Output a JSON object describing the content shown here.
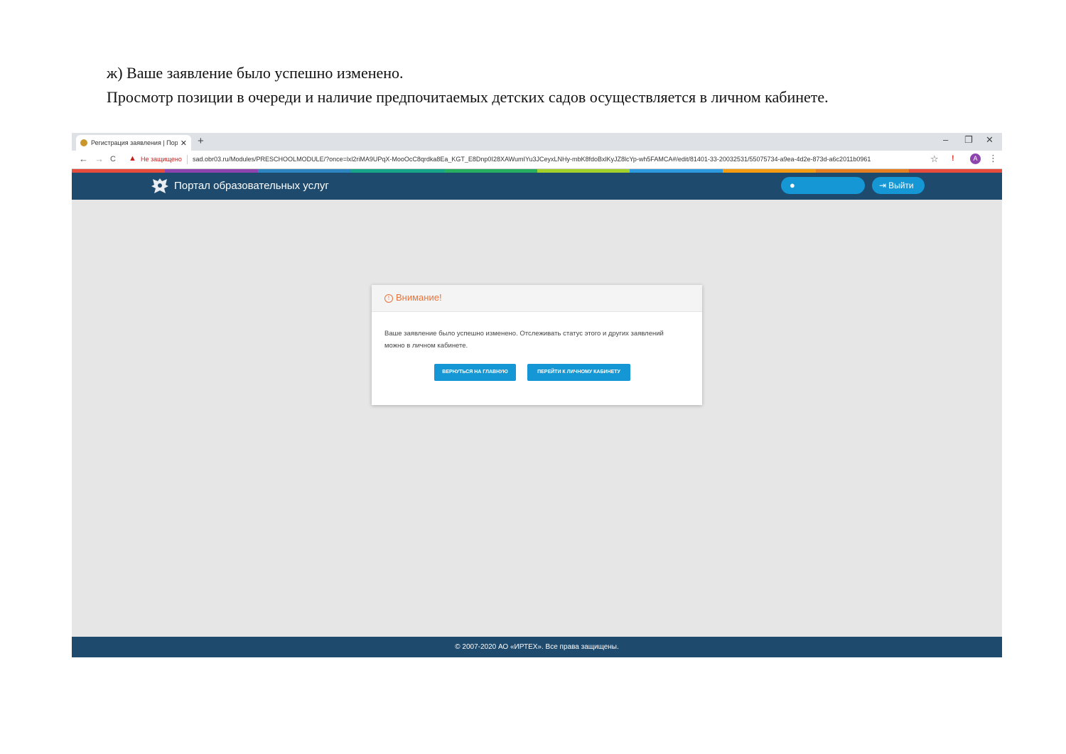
{
  "document": {
    "line1": "ж) Ваше заявление было успешно изменено.",
    "line2": "Просмотр позиции в очереди и наличие предпочитаемых детских садов осуществляется в личном кабинете."
  },
  "browser": {
    "tab_title": "Регистрация заявления | Порта",
    "tab_close": "✕",
    "new_tab": "+",
    "window_controls": {
      "minimize": "–",
      "restore": "❐",
      "close": "✕"
    },
    "nav": {
      "back": "←",
      "forward": "→",
      "reload": "C"
    },
    "security_warning": "Не защищено",
    "url": "sad.obr03.ru/Modules/PRESCHOOLMODULE/?once=lxl2riMA9UPqX-MooOcC8qrdka8Ea_KGT_E8Dnp0I28XAWumIYu3JCeyxLNHy-mbK8fdoBxlKyJZ8lcYp-wh5FAMCA#/edit/81401-33-20032531/55075734-a9ea-4d2e-873d-a6c2011b0961",
    "profile_letter": "A",
    "stripe_colors": [
      "#e74c3c",
      "#8e44ad",
      "#2e86c1",
      "#17a589",
      "#27ae60",
      "#a3d12b",
      "#2e9be0",
      "#f39c12",
      "#e67e22",
      "#e74c3c"
    ]
  },
  "site": {
    "title": "Портал образовательных услуг",
    "user_icon": "user-circle-icon",
    "logout_label": "Выйти",
    "header_color": "#1e4a6e",
    "accent_color": "#1597d5"
  },
  "modal": {
    "title": "Внимание!",
    "title_color": "#e8733a",
    "message": "Ваше заявление было успешно изменено. Отслеживать статус этого и других заявлений можно в личном кабинете.",
    "btn_home": "ВЕРНУТЬСЯ НА ГЛАВНУЮ",
    "btn_cabinet": "ПЕРЕЙТИ К ЛИЧНОМУ КАБИНЕТУ"
  },
  "footer": {
    "copyright": "© 2007-2020 АО «ИРТЕХ». Все права защищены."
  }
}
